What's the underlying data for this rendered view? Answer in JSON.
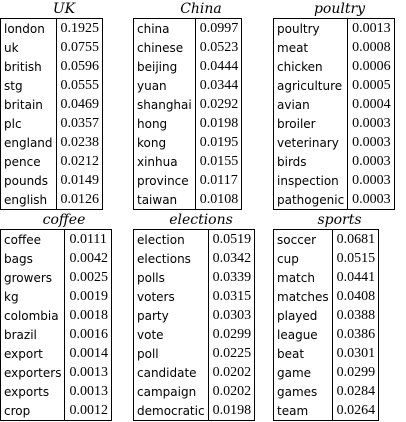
{
  "panels": [
    {
      "title": "UK",
      "rows": [
        {
          "word": "london",
          "prob": "0.1925"
        },
        {
          "word": "uk",
          "prob": "0.0755"
        },
        {
          "word": "british",
          "prob": "0.0596"
        },
        {
          "word": "stg",
          "prob": "0.0555"
        },
        {
          "word": "britain",
          "prob": "0.0469"
        },
        {
          "word": "plc",
          "prob": "0.0357"
        },
        {
          "word": "england",
          "prob": "0.0238"
        },
        {
          "word": "pence",
          "prob": "0.0212"
        },
        {
          "word": "pounds",
          "prob": "0.0149"
        },
        {
          "word": "english",
          "prob": "0.0126"
        }
      ]
    },
    {
      "title": "China",
      "rows": [
        {
          "word": "china",
          "prob": "0.0997"
        },
        {
          "word": "chinese",
          "prob": "0.0523"
        },
        {
          "word": "beijing",
          "prob": "0.0444"
        },
        {
          "word": "yuan",
          "prob": "0.0344"
        },
        {
          "word": "shanghai",
          "prob": "0.0292"
        },
        {
          "word": "hong",
          "prob": "0.0198"
        },
        {
          "word": "kong",
          "prob": "0.0195"
        },
        {
          "word": "xinhua",
          "prob": "0.0155"
        },
        {
          "word": "province",
          "prob": "0.0117"
        },
        {
          "word": "taiwan",
          "prob": "0.0108"
        }
      ]
    },
    {
      "title": "poultry",
      "rows": [
        {
          "word": "poultry",
          "prob": "0.0013"
        },
        {
          "word": "meat",
          "prob": "0.0008"
        },
        {
          "word": "chicken",
          "prob": "0.0006"
        },
        {
          "word": "agriculture",
          "prob": "0.0005"
        },
        {
          "word": "avian",
          "prob": "0.0004"
        },
        {
          "word": "broiler",
          "prob": "0.0003"
        },
        {
          "word": "veterinary",
          "prob": "0.0003"
        },
        {
          "word": "birds",
          "prob": "0.0003"
        },
        {
          "word": "inspection",
          "prob": "0.0003"
        },
        {
          "word": "pathogenic",
          "prob": "0.0003"
        }
      ]
    },
    {
      "title": "coffee",
      "rows": [
        {
          "word": "coffee",
          "prob": "0.0111"
        },
        {
          "word": "bags",
          "prob": "0.0042"
        },
        {
          "word": "growers",
          "prob": "0.0025"
        },
        {
          "word": "kg",
          "prob": "0.0019"
        },
        {
          "word": "colombia",
          "prob": "0.0018"
        },
        {
          "word": "brazil",
          "prob": "0.0016"
        },
        {
          "word": "export",
          "prob": "0.0014"
        },
        {
          "word": "exporters",
          "prob": "0.0013"
        },
        {
          "word": "exports",
          "prob": "0.0013"
        },
        {
          "word": "crop",
          "prob": "0.0012"
        }
      ]
    },
    {
      "title": "elections",
      "rows": [
        {
          "word": "election",
          "prob": "0.0519"
        },
        {
          "word": "elections",
          "prob": "0.0342"
        },
        {
          "word": "polls",
          "prob": "0.0339"
        },
        {
          "word": "voters",
          "prob": "0.0315"
        },
        {
          "word": "party",
          "prob": "0.0303"
        },
        {
          "word": "vote",
          "prob": "0.0299"
        },
        {
          "word": "poll",
          "prob": "0.0225"
        },
        {
          "word": "candidate",
          "prob": "0.0202"
        },
        {
          "word": "campaign",
          "prob": "0.0202"
        },
        {
          "word": "democratic",
          "prob": "0.0198"
        }
      ]
    },
    {
      "title": "sports",
      "rows": [
        {
          "word": "soccer",
          "prob": "0.0681"
        },
        {
          "word": "cup",
          "prob": "0.0515"
        },
        {
          "word": "match",
          "prob": "0.0441"
        },
        {
          "word": "matches",
          "prob": "0.0408"
        },
        {
          "word": "played",
          "prob": "0.0388"
        },
        {
          "word": "league",
          "prob": "0.0386"
        },
        {
          "word": "beat",
          "prob": "0.0301"
        },
        {
          "word": "game",
          "prob": "0.0299"
        },
        {
          "word": "games",
          "prob": "0.0284"
        },
        {
          "word": "team",
          "prob": "0.0264"
        }
      ]
    }
  ]
}
